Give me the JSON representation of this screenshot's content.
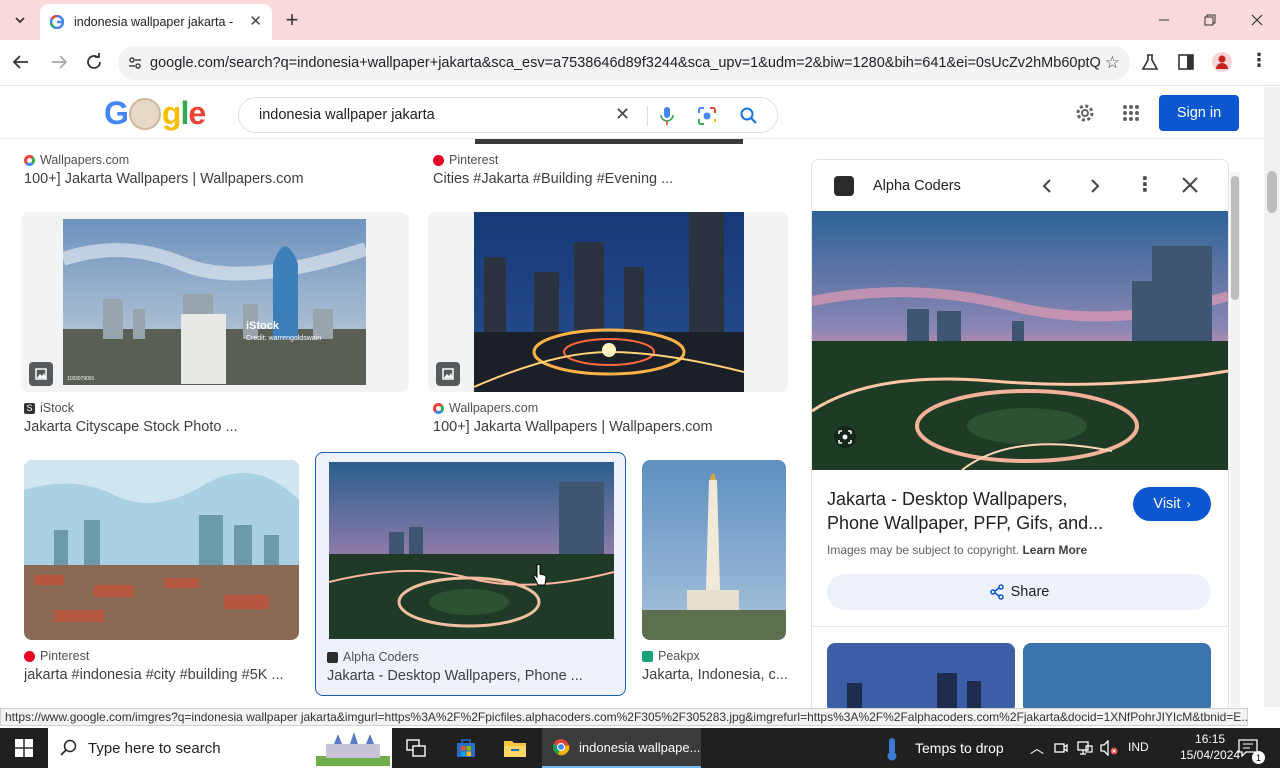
{
  "browser": {
    "tab_title": "indonesia wallpaper jakarta - G",
    "url": "google.com/search?q=indonesia+wallpaper+jakarta&sca_esv=a7538646d89f3244&sca_upv=1&udm=2&biw=1280&bih=641&ei=0sUcZv2hMb60ptQP6..."
  },
  "google": {
    "logo": "Google",
    "query": "indonesia wallpaper jakarta",
    "sign_in": "Sign in"
  },
  "results": {
    "row0": [
      {
        "source": "Wallpapers.com",
        "title": "100+] Jakarta Wallpapers | Wallpapers.com"
      },
      {
        "source": "Pinterest",
        "title": "Cities #Jakarta #Building #Evening ..."
      }
    ],
    "row1": [
      {
        "source": "iStock",
        "title": "Jakarta Cityscape Stock Photo ...",
        "watermark": "iStock",
        "credit": "Credit: warrengoldswain",
        "id": "1183079091"
      },
      {
        "source": "Wallpapers.com",
        "title": "100+] Jakarta Wallpapers | Wallpapers.com"
      }
    ],
    "row2": [
      {
        "source": "Pinterest",
        "title": "jakarta #indonesia #city #building #5K ..."
      },
      {
        "source": "Alpha Coders",
        "title": "Jakarta - Desktop Wallpapers, Phone ..."
      },
      {
        "source": "Peakpx",
        "title": "Jakarta, Indonesia, c..."
      }
    ]
  },
  "panel": {
    "source": "Alpha Coders",
    "title": "Jakarta - Desktop Wallpapers, Phone Wallpaper, PFP, Gifs, and...",
    "visit": "Visit",
    "copyright": "Images may be subject to copyright.",
    "learn_more": "Learn More",
    "share": "Share"
  },
  "status_url": "https://www.google.com/imgres?q=indonesia wallpaper jakarta&imgurl=https%3A%2F%2Fpicfiles.alphacoders.com%2F305%2F305283.jpg&imgrefurl=https%3A%2F%2Falphacoders.com%2Fjakarta&docid=1XNfPohrJIYIcM&tbnid=E...",
  "taskbar": {
    "search_placeholder": "Type here to search",
    "chrome_label": "indonesia wallpape...",
    "weather": "Temps to drop",
    "lang": "IND",
    "time": "16:15",
    "date": "15/04/2024",
    "notif_count": "1"
  },
  "colors": {
    "accent": "#0b57d0",
    "tabstrip": "#f9d9d9",
    "pinterest": "#e60023",
    "taskbar": "#202020"
  }
}
